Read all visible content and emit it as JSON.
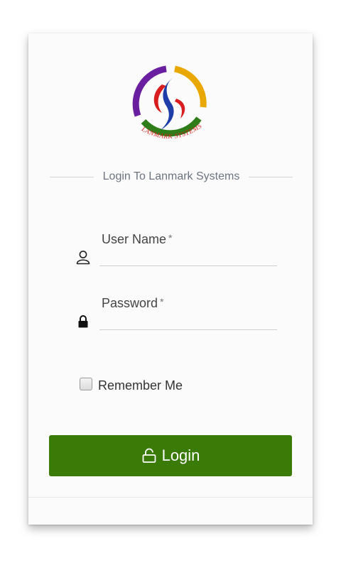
{
  "logo": {
    "text": "LANMARK SYSTEMS",
    "colors": {
      "purple": "#6a1fa0",
      "yellow": "#e8a800",
      "green": "#2f7d1a",
      "red": "#d81e1e",
      "blue": "#1d3ea8"
    }
  },
  "header": {
    "title": "Login To Lanmark Systems"
  },
  "form": {
    "username": {
      "label": "User Name",
      "required_mark": "*",
      "value": "",
      "icon": "user-icon"
    },
    "password": {
      "label": "Password",
      "required_mark": "*",
      "value": "",
      "icon": "lock-icon"
    },
    "remember": {
      "label": "Remember Me",
      "checked": false
    },
    "submit": {
      "label": "Login",
      "icon": "unlock-icon",
      "color": "#3a7a06"
    }
  }
}
